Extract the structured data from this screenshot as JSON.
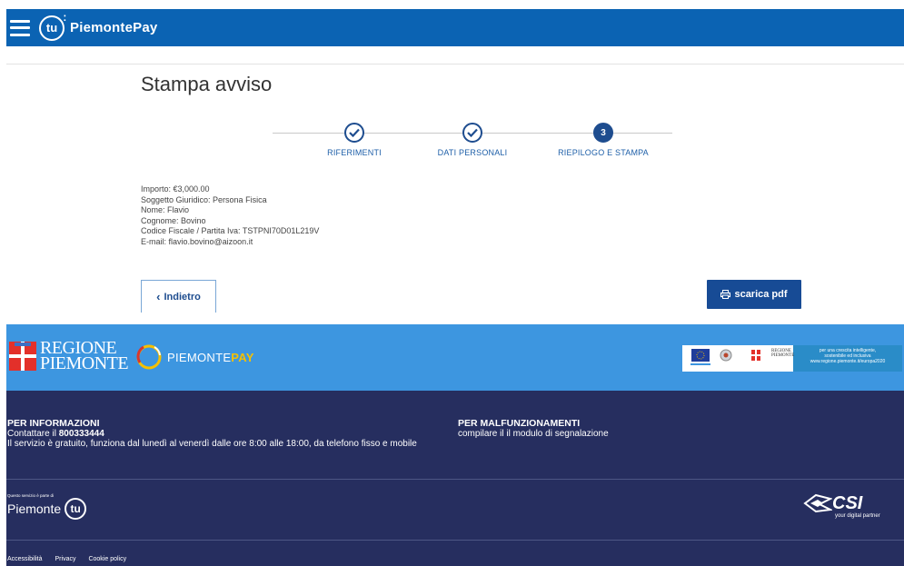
{
  "header": {
    "brand": "PiemontePay",
    "logo_text": "tu"
  },
  "page": {
    "title": "Stampa avviso",
    "steps": [
      {
        "label": "RIFERIMENTI",
        "state": "done"
      },
      {
        "label": "DATI PERSONALI",
        "state": "done"
      },
      {
        "label": "RIEPILOGO E STAMPA",
        "state": "active",
        "number": "3"
      }
    ],
    "summary": [
      "Importo: €3,000.00",
      "Soggetto Giuridico: Persona Fisica",
      "Nome: Flavio",
      "Cognome: Bovino",
      "Codice Fiscale / Partita Iva: TSTPNI70D01L219V",
      "E-mail: flavio.bovino@aizoon.it"
    ],
    "back_button": "Indietro",
    "pdf_button": "scarica pdf"
  },
  "footer": {
    "regione": [
      "REGIONE",
      "PIEMONTE"
    ],
    "piemontepay": {
      "part1": "PIEMONTE",
      "part2": "PAY"
    },
    "eu_tag": [
      "per una crescita intelligente,",
      "sostenibile ed inclusiva",
      "www.regione.piemonte.it/europa2020"
    ],
    "info_heading": "PER INFORMAZIONI",
    "info_contact_prefix": "Contattare il ",
    "info_phone": "800333444",
    "info_hours": "Il servizio è gratuito, funziona dal lunedì al venerdì dalle ore 8:00 alle 18:00, da telefono fisso e mobile",
    "malf_heading": "PER MALFUNZIONAMENTI",
    "malf_text": "compilare il il modulo di segnalazione",
    "service_part": "Questo servizio è parte di",
    "piemonte_word": "Piemonte",
    "tu_word": "tu",
    "csi": "CSI",
    "csi_tagline": "your digital partner",
    "links": [
      "Accessibilità",
      "Privacy",
      "Cookie policy"
    ]
  },
  "colors": {
    "primary": "#0b63b3",
    "accent": "#174b95",
    "footer_blue": "#3d96e0",
    "footer_dark": "#262e5f"
  }
}
